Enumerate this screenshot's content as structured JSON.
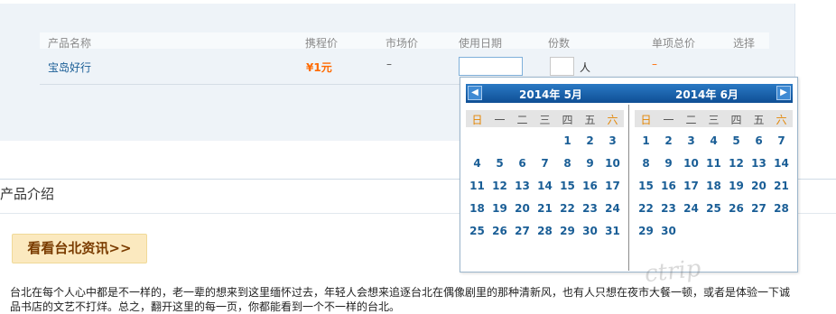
{
  "table": {
    "headers": [
      "产品名称",
      "携程价",
      "市场价",
      "使用日期",
      "份数",
      "单项总价",
      "选择"
    ],
    "row": {
      "name": "宝岛好行",
      "price": "¥1元",
      "market": "–",
      "quantity_value": "",
      "unit": "人",
      "subtotal": "–"
    }
  },
  "section": {
    "title": "产品介绍",
    "news_button": "看看台北资讯>>"
  },
  "description": {
    "line1": "台北在每个人心中都是不一样的，老一辈的想来到这里缅怀过去，年轻人会想来追逐台北在偶像剧里的那种清新风，也有人只想在夜市大餐一顿，或者是体验一下诚",
    "line2": "品书店的文艺不打烊。总之，翻开这里的每一页，你都能看到一个不一样的台北。"
  },
  "calendar": {
    "prev_icon": "◀",
    "next_icon": "▶",
    "weekdays": [
      "日",
      "一",
      "二",
      "三",
      "四",
      "五",
      "六"
    ],
    "months": [
      {
        "title": "2014年 5月",
        "first_weekday": 4,
        "days": 31
      },
      {
        "title": "2014年 6月",
        "first_weekday": 0,
        "days": 30
      }
    ]
  },
  "colors": {
    "accent": "#1a5e96",
    "price": "#ff6a00",
    "header_bar": "#0f4f95",
    "weekend": "#e38400"
  },
  "watermark": "ctrip"
}
